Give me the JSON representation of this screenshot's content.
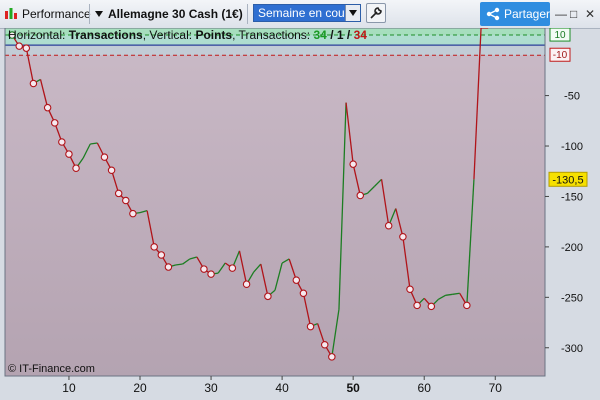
{
  "toolbar": {
    "performance_label": "Performance",
    "instrument_label": "Allemagne 30 Cash (1€)",
    "period_value": "Semaine en cours",
    "share_label": "Partager",
    "minimize_label": "—",
    "maximize_label": "□",
    "close_label": "✕"
  },
  "legend": {
    "horizontal_prefix": "Horizontal:",
    "horizontal_value": "Transactions",
    "vertical_prefix": ", Vertical:",
    "vertical_value": "Points",
    "transactions_prefix": ", Transactions:",
    "wins": "34",
    "sep1": " / ",
    "neutral": "1",
    "sep2": " / ",
    "losses": "34"
  },
  "copyright": "© IT-Finance.com",
  "colors": {
    "profit_zone": "#a8e0bf",
    "loss_zone": "#c9b9c6",
    "line_up": "#1c7d22",
    "line_down": "#b0141a",
    "marker_fill": "#f6e9ef",
    "price_tag": "#f6e000",
    "pos_tag_border": "#1c8d26",
    "neg_tag_border": "#c01818"
  },
  "chart_data": {
    "type": "line",
    "xlabel": "",
    "ylabel": "",
    "xlim": [
      1,
      77
    ],
    "ylim": [
      -328,
      17
    ],
    "x_ticks": [
      10,
      20,
      30,
      40,
      50,
      60,
      70
    ],
    "x_bold_tick": 50,
    "y_ticks": [
      -50,
      -100,
      -150,
      -200,
      -250,
      -300
    ],
    "ref_lines": [
      10,
      0,
      -10
    ],
    "current_value_label": "-130,5",
    "pos_level_label": "10",
    "neg_level_label": "-10",
    "x": [
      2,
      3,
      4,
      5,
      6,
      7,
      8,
      9,
      10,
      11,
      12,
      13,
      14,
      15,
      16,
      17,
      18,
      19,
      20,
      21,
      22,
      23,
      24,
      25,
      26,
      27,
      28,
      29,
      30,
      31,
      32,
      33,
      34,
      35,
      36,
      37,
      38,
      39,
      40,
      41,
      42,
      43,
      44,
      45,
      46,
      47,
      48,
      49,
      50,
      51,
      52,
      53,
      54,
      55,
      56,
      57,
      58,
      59,
      60,
      61,
      62,
      63,
      64,
      65,
      66,
      67,
      68,
      69
    ],
    "y": [
      10,
      -1,
      -3,
      -38,
      -34,
      -62,
      -77,
      -96,
      -108,
      -122,
      -112,
      -98,
      -97,
      -111,
      -124,
      -147,
      -154,
      -167,
      -166,
      -164,
      -200,
      -208,
      -220,
      -218,
      -217,
      -212,
      -210,
      -222,
      -227,
      -226,
      -216,
      -221,
      -204,
      -237,
      -225,
      -217,
      -249,
      -243,
      -216,
      -212,
      -233,
      -246,
      -279,
      -276,
      -297,
      -309,
      -262,
      -57,
      -118,
      -149,
      -147,
      -140,
      -133,
      -179,
      -162,
      -190,
      -242,
      -258,
      -251,
      -259,
      -252,
      -248,
      -247,
      -246,
      -258,
      -133
    ]
  }
}
